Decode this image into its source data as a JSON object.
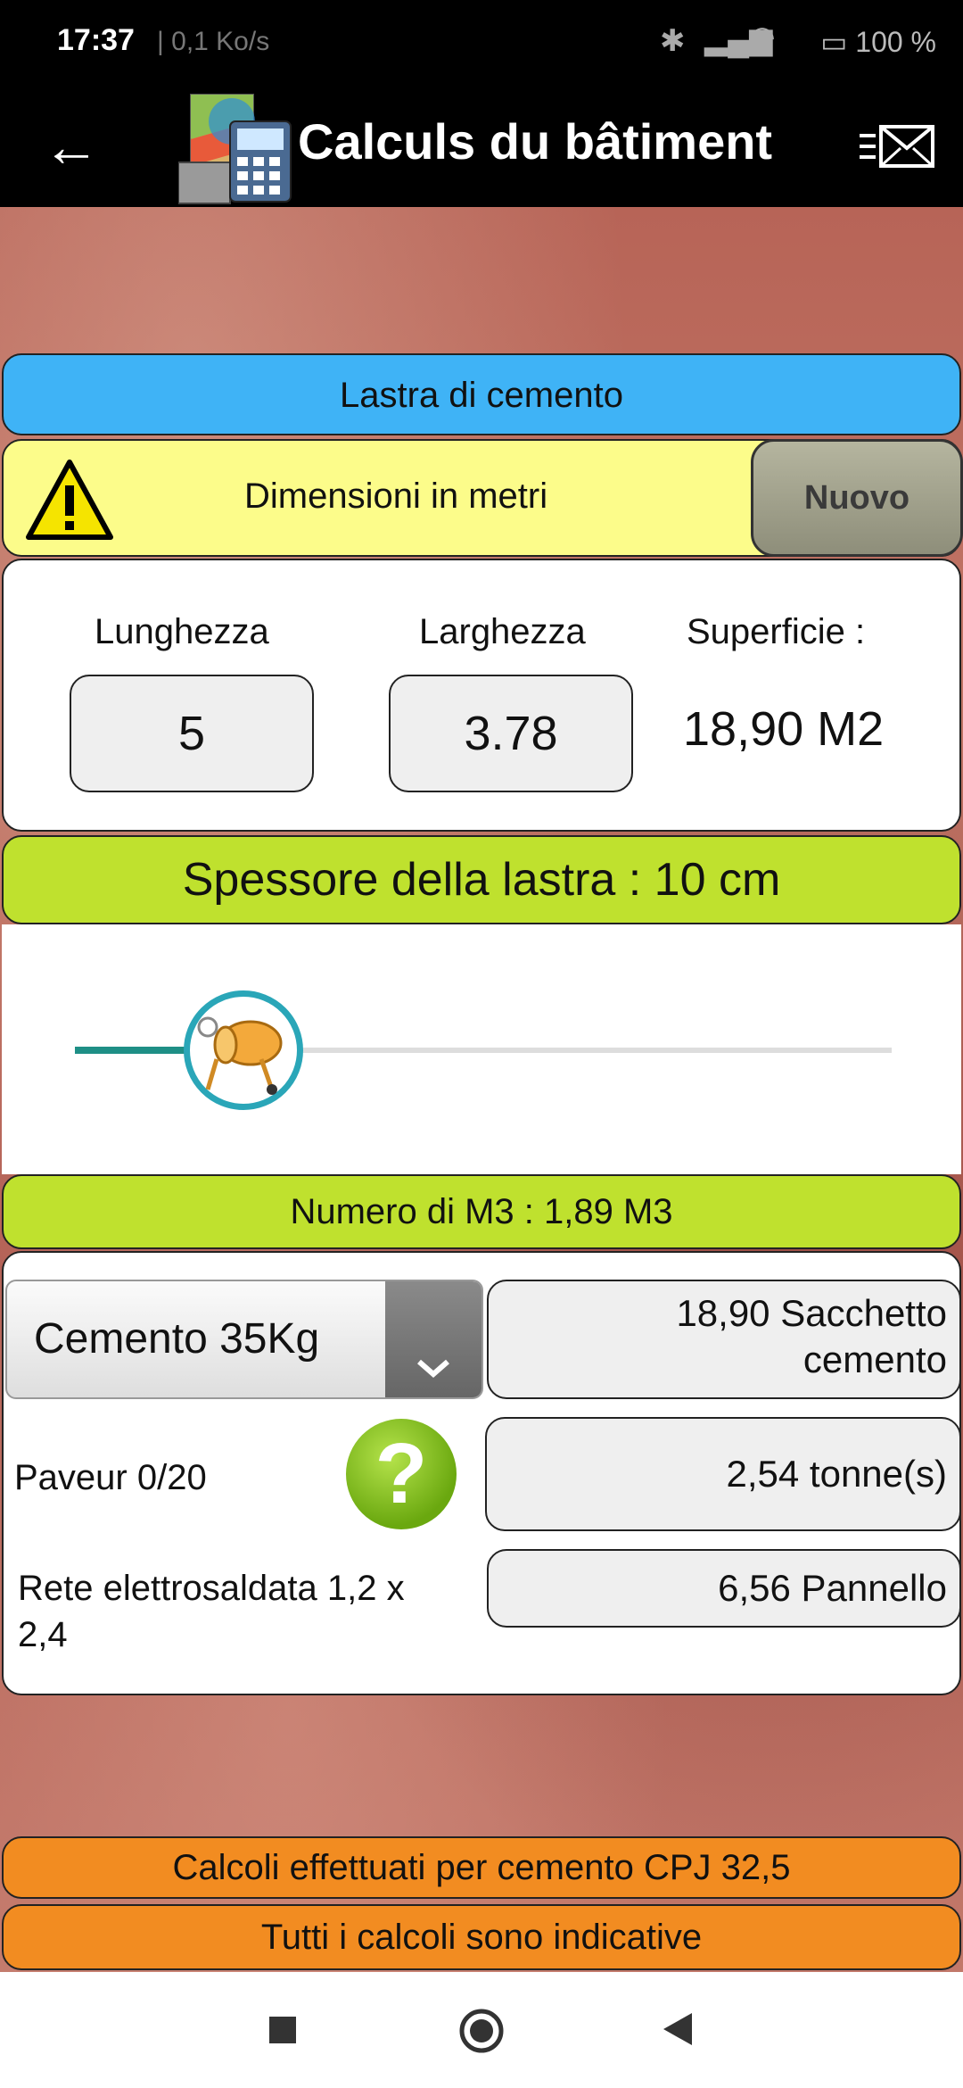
{
  "status": {
    "time": "17:37",
    "network": "| 0,1 Ko/s",
    "battery": "100 %"
  },
  "appbar": {
    "title": "Calculs du bâtiment"
  },
  "header": {
    "title": "Lastra di cemento"
  },
  "dimensions": {
    "note": "Dimensioni in metri",
    "new_button": "Nuovo"
  },
  "inputs": {
    "length_label": "Lunghezza",
    "length_value": "5",
    "width_label": "Larghezza",
    "width_value": "3.78",
    "area_label": "Superficie :",
    "area_value": "18,90 M2"
  },
  "thickness": {
    "label": "Spessore della lastra : 10 cm",
    "slider_fraction": 0.13
  },
  "volume": {
    "label": "Numero di M3 : 1,89 M3"
  },
  "materials": {
    "cement_select": "Cemento 35Kg",
    "cement_result_line1": "18,90 Sacchetto",
    "cement_result_line2": "cemento",
    "paver_label": "Paveur 0/20",
    "paver_result": "2,54 tonne(s)",
    "mesh_label_line1": "Rete elettrosaldata 1,2 x",
    "mesh_label_line2": "2,4",
    "mesh_result": "6,56 Pannello"
  },
  "notes": {
    "line1": "Calcoli effettuati per cemento CPJ 32,5",
    "line2": "Tutti i calcoli sono indicative"
  },
  "colors": {
    "header_blue": "#3fb3f6",
    "lime": "#bfe12e",
    "orange": "#f28c21",
    "yellow": "#fcfc8a"
  }
}
